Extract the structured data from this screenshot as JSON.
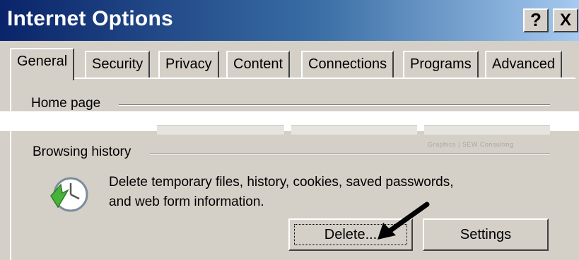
{
  "window": {
    "title": "Internet Options",
    "help_label": "?",
    "close_label": "X"
  },
  "tabs": [
    {
      "label": "General",
      "active": true
    },
    {
      "label": "Security"
    },
    {
      "label": "Privacy"
    },
    {
      "label": "Content"
    },
    {
      "label": "Connections"
    },
    {
      "label": "Programs"
    },
    {
      "label": "Advanced"
    }
  ],
  "general": {
    "home_page_label": "Home page",
    "browsing_history_label": "Browsing history",
    "history_description_line1": "Delete temporary files, history, cookies, saved passwords,",
    "history_description_line2": "and web form information.",
    "delete_button": "Delete...",
    "settings_button": "Settings"
  },
  "watermark": "Graphics | SEW Consulting",
  "colors": {
    "title_start": "#0a246a",
    "title_end": "#a6caf0",
    "face": "#d4d0c8"
  },
  "icons": {
    "history": "history-clock-icon",
    "pointer": "black-arrow-pointer-icon"
  }
}
